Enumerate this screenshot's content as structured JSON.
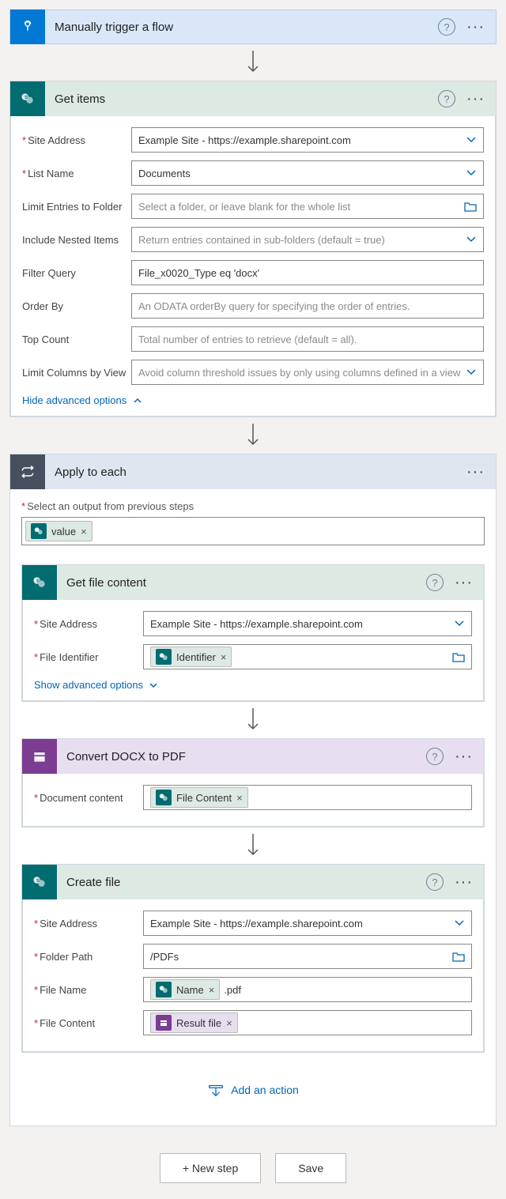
{
  "trigger": {
    "title": "Manually trigger a flow"
  },
  "getItems": {
    "title": "Get items",
    "siteAddress": {
      "label": "Site Address",
      "value": "Example Site - https://example.sharepoint.com"
    },
    "listName": {
      "label": "List Name",
      "value": "Documents"
    },
    "limitFolder": {
      "label": "Limit Entries to Folder",
      "placeholder": "Select a folder, or leave blank for the whole list"
    },
    "includeNested": {
      "label": "Include Nested Items",
      "placeholder": "Return entries contained in sub-folders (default = true)"
    },
    "filterQuery": {
      "label": "Filter Query",
      "value": "File_x0020_Type eq 'docx'"
    },
    "orderBy": {
      "label": "Order By",
      "placeholder": "An ODATA orderBy query for specifying the order of entries."
    },
    "topCount": {
      "label": "Top Count",
      "placeholder": "Total number of entries to retrieve (default = all)."
    },
    "limitCols": {
      "label": "Limit Columns by View",
      "placeholder": "Avoid column threshold issues by only using columns defined in a view"
    },
    "hideAdv": "Hide advanced options"
  },
  "applyEach": {
    "title": "Apply to each",
    "selectLabel": "Select an output from previous steps",
    "token": "value"
  },
  "getFile": {
    "title": "Get file content",
    "siteAddress": {
      "label": "Site Address",
      "value": "Example Site - https://example.sharepoint.com"
    },
    "fileId": {
      "label": "File Identifier",
      "token": "Identifier"
    },
    "showAdv": "Show advanced options"
  },
  "convert": {
    "title": "Convert DOCX to PDF",
    "docContent": {
      "label": "Document content",
      "token": "File Content"
    }
  },
  "createFile": {
    "title": "Create file",
    "siteAddress": {
      "label": "Site Address",
      "value": "Example Site - https://example.sharepoint.com"
    },
    "folderPath": {
      "label": "Folder Path",
      "value": "/PDFs"
    },
    "fileName": {
      "label": "File Name",
      "token": "Name",
      "suffix": ".pdf"
    },
    "fileContent": {
      "label": "File Content",
      "token": "Result file"
    }
  },
  "addAction": "Add an action",
  "newStep": "+ New step",
  "save": "Save"
}
